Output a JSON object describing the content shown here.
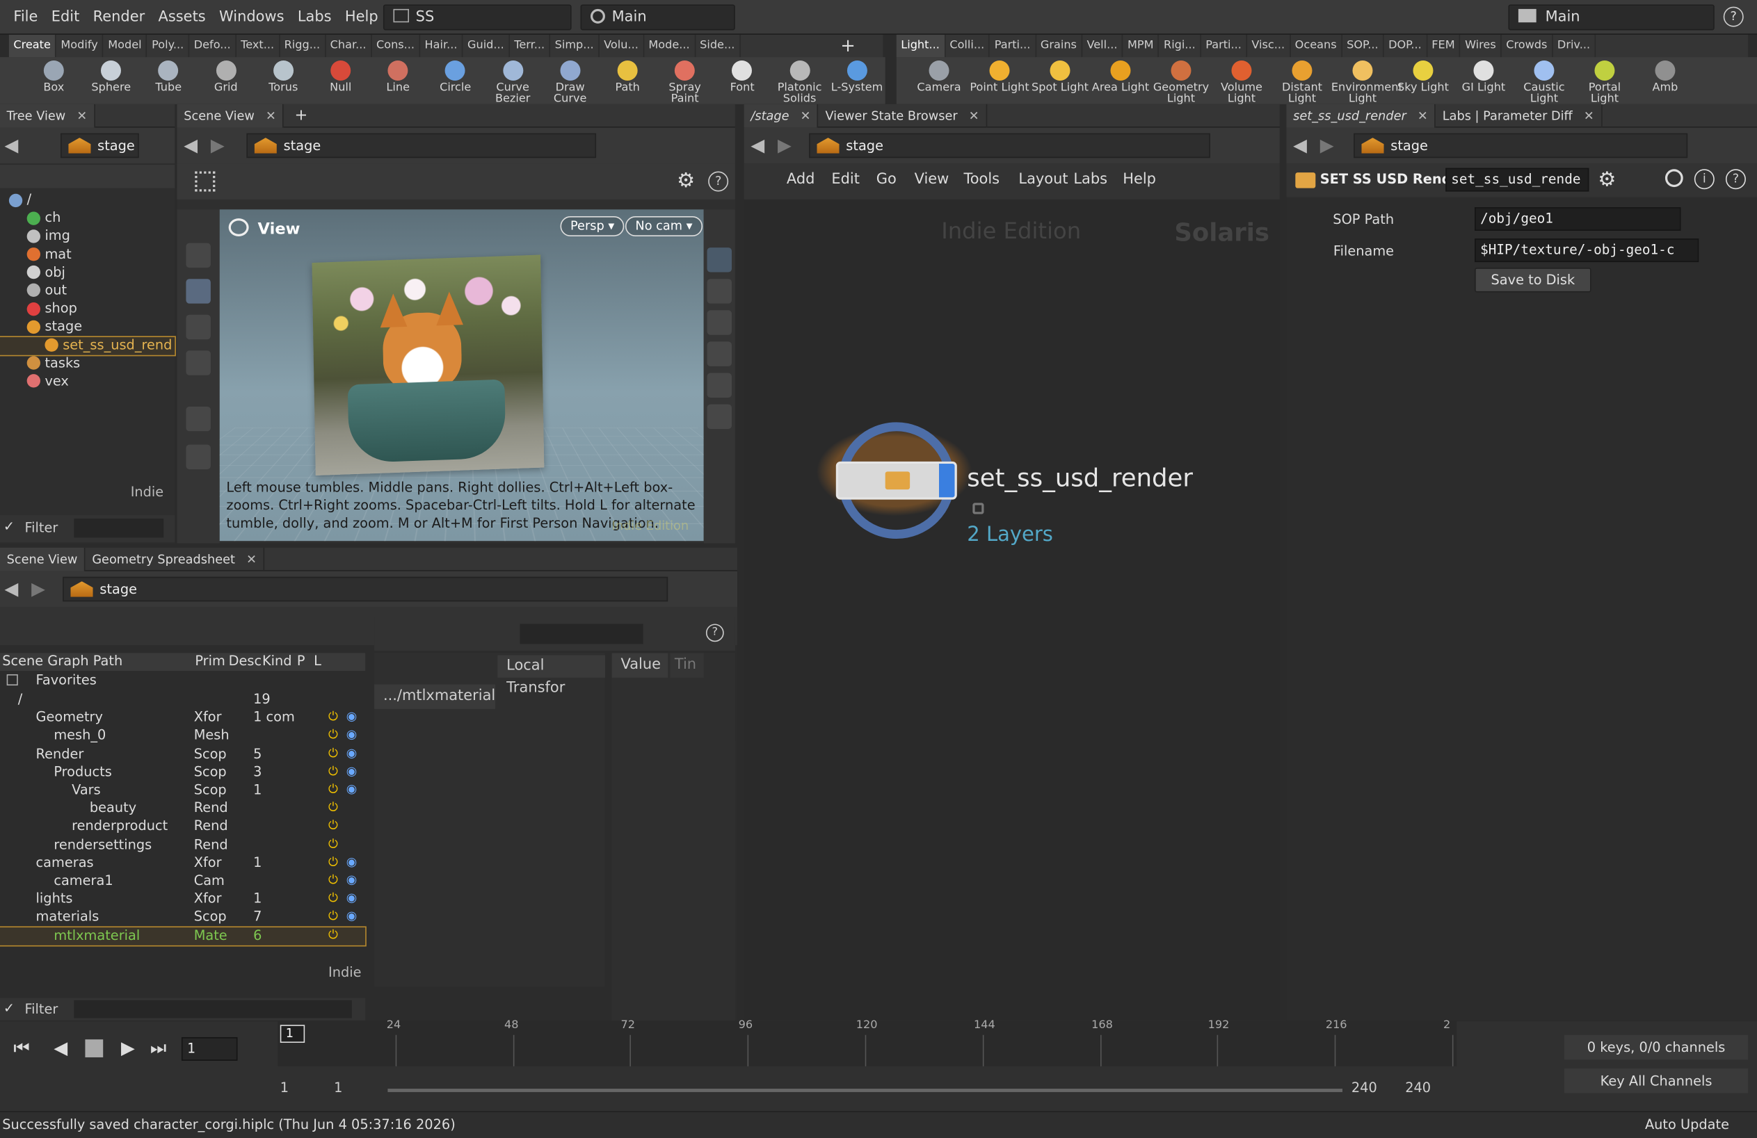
{
  "menubar": {
    "items": [
      "File",
      "Edit",
      "Render",
      "Assets",
      "Windows",
      "Labs",
      "Help"
    ],
    "desktop": "SS",
    "context": "Main",
    "right_context": "Main"
  },
  "shelf": {
    "left_tabs": [
      "Create",
      "Modify",
      "Model",
      "Poly...",
      "Defo...",
      "Text...",
      "Rigg...",
      "Char...",
      "Cons...",
      "Hair...",
      "Guid...",
      "Terr...",
      "Simp...",
      "Volu...",
      "Mode...",
      "Side..."
    ],
    "right_tabs": [
      "Light...",
      "Colli...",
      "Parti...",
      "Grains",
      "Vell...",
      "MPM",
      "Rigi...",
      "Parti...",
      "Visc...",
      "Oceans",
      "SOP...",
      "DOP...",
      "FEM",
      "Wires",
      "Crowds",
      "Driv..."
    ],
    "left_tools": [
      {
        "label": "Box",
        "color": "#9aa6b4"
      },
      {
        "label": "Sphere",
        "color": "#c8d0d8"
      },
      {
        "label": "Tube",
        "color": "#aab4c0"
      },
      {
        "label": "Grid",
        "color": "#b0b0b0"
      },
      {
        "label": "Torus",
        "color": "#b8c4cc"
      },
      {
        "label": "Null",
        "color": "#d84a3a"
      },
      {
        "label": "Line",
        "color": "#d07060"
      },
      {
        "label": "Circle",
        "color": "#6aa0e0"
      },
      {
        "label": "Curve Bezier",
        "color": "#a0b8d8"
      },
      {
        "label": "Draw Curve",
        "color": "#90a8d0"
      },
      {
        "label": "Path",
        "color": "#e8c040"
      },
      {
        "label": "Spray Paint",
        "color": "#e07060"
      },
      {
        "label": "Font",
        "color": "#e0e0e0"
      },
      {
        "label": "Platonic Solids",
        "color": "#b8b8b8"
      },
      {
        "label": "L-System",
        "color": "#5a9ae0"
      }
    ],
    "right_tools": [
      {
        "label": "Camera",
        "color": "#9aa0a8"
      },
      {
        "label": "Point Light",
        "color": "#f0b030"
      },
      {
        "label": "Spot Light",
        "color": "#f0c040"
      },
      {
        "label": "Area Light",
        "color": "#e8a020"
      },
      {
        "label": "Geometry Light",
        "color": "#d07040"
      },
      {
        "label": "Volume Light",
        "color": "#e06030"
      },
      {
        "label": "Distant Light",
        "color": "#e8a030"
      },
      {
        "label": "Environment Light",
        "color": "#f0c060"
      },
      {
        "label": "Sky Light",
        "color": "#e8d040"
      },
      {
        "label": "GI Light",
        "color": "#e0e0e0"
      },
      {
        "label": "Caustic Light",
        "color": "#a0c0f0"
      },
      {
        "label": "Portal Light",
        "color": "#c0d040"
      },
      {
        "label": "Amb",
        "color": "#909090"
      }
    ]
  },
  "tree_view": {
    "tab": "Tree View",
    "path": "stage",
    "items": [
      {
        "label": "/",
        "depth": 0,
        "color": "#7aa0d0"
      },
      {
        "label": "ch",
        "depth": 1,
        "color": "#4caf50"
      },
      {
        "label": "img",
        "depth": 1,
        "color": "#c0c0c0"
      },
      {
        "label": "mat",
        "depth": 1,
        "color": "#e07030"
      },
      {
        "label": "obj",
        "depth": 1,
        "color": "#d0d0d0"
      },
      {
        "label": "out",
        "depth": 1,
        "color": "#b0b0b0"
      },
      {
        "label": "shop",
        "depth": 1,
        "color": "#e04040"
      },
      {
        "label": "stage",
        "depth": 1,
        "color": "#e39a2e"
      },
      {
        "label": "set_ss_usd_rend",
        "depth": 2,
        "color": "#e39a2e"
      },
      {
        "label": "tasks",
        "depth": 1,
        "color": "#d09040"
      },
      {
        "label": "vex",
        "depth": 1,
        "color": "#e07070"
      }
    ],
    "indie_label": "Indie",
    "filter_label": "Filter"
  },
  "scene_view_top": {
    "tab": "Scene View",
    "path": "stage",
    "view_title": "View",
    "persp": "Persp",
    "cam": "No cam",
    "hint": "Left mouse tumbles. Middle pans. Right dollies. Ctrl+Alt+Left box-zooms. Ctrl+Right zooms. Spacebar-Ctrl-Left tilts. Hold L for alternate tumble, dolly, and zoom. M or Alt+M for First Person Navigation.",
    "watermark": "Indie Edition"
  },
  "network": {
    "tabs": [
      "/stage",
      "Viewer State Browser"
    ],
    "path": "stage",
    "menu": [
      "Add",
      "Edit",
      "Go",
      "View",
      "Tools",
      "Layout",
      "Labs",
      "Help"
    ],
    "edition": "Indie Edition",
    "context_label": "Solaris",
    "node_name": "set_ss_usd_render",
    "node_info": "2 Layers"
  },
  "params": {
    "tabs": [
      "set_ss_usd_render",
      "Labs | Parameter Diff"
    ],
    "path": "stage",
    "node_type": "SET SS USD Render",
    "node_name": "set_ss_usd_rende",
    "sop_path_label": "SOP Path",
    "sop_path": "/obj/geo1",
    "filename_label": "Filename",
    "filename": "$HIP/texture/-obj-geo1-c",
    "save_button": "Save to Disk"
  },
  "scene_graph": {
    "tabs": [
      "Scene View",
      "Geometry Spreadsheet"
    ],
    "path": "stage",
    "headers": {
      "path": "Scene Graph Path",
      "prim": "Prim",
      "desc": "Desc",
      "kind": "Kind",
      "p": "P",
      "l": "L"
    },
    "favorites": "Favorites",
    "rows": [
      {
        "name": "/",
        "depth": 0,
        "prim": "",
        "desc": "19",
        "power": false,
        "eye": false
      },
      {
        "name": "Geometry",
        "depth": 1,
        "prim": "Xfor",
        "desc": "1 com",
        "power": true,
        "eye": true
      },
      {
        "name": "mesh_0",
        "depth": 2,
        "prim": "Mesh",
        "desc": "",
        "power": true,
        "eye": true
      },
      {
        "name": "Render",
        "depth": 1,
        "prim": "Scop",
        "desc": "5",
        "power": true,
        "eye": true
      },
      {
        "name": "Products",
        "depth": 2,
        "prim": "Scop",
        "desc": "3",
        "power": true,
        "eye": true
      },
      {
        "name": "Vars",
        "depth": 3,
        "prim": "Scop",
        "desc": "1",
        "power": true,
        "eye": true
      },
      {
        "name": "beauty",
        "depth": 4,
        "prim": "Rend",
        "desc": "",
        "power": true,
        "eye": false
      },
      {
        "name": "renderproduct",
        "depth": 3,
        "prim": "Rend",
        "desc": "",
        "power": true,
        "eye": false
      },
      {
        "name": "rendersettings",
        "depth": 2,
        "prim": "Rend",
        "desc": "",
        "power": true,
        "eye": false
      },
      {
        "name": "cameras",
        "depth": 1,
        "prim": "Xfor",
        "desc": "1",
        "power": true,
        "eye": true
      },
      {
        "name": "camera1",
        "depth": 2,
        "prim": "Cam",
        "desc": "",
        "power": true,
        "eye": true
      },
      {
        "name": "lights",
        "depth": 1,
        "prim": "Xfor",
        "desc": "1",
        "power": true,
        "eye": true
      },
      {
        "name": "materials",
        "depth": 1,
        "prim": "Scop",
        "desc": "7",
        "power": true,
        "eye": true
      },
      {
        "name": "mtlxmaterial",
        "depth": 2,
        "prim": "Mate",
        "desc": "6",
        "power": true,
        "eye": false,
        "selected": true
      }
    ],
    "indie_label": "Indie",
    "filter_label": "Filter"
  },
  "spreadsheet": {
    "local_transform": "Local Transfor",
    "value": "Value",
    "time": "Tin",
    "item": ".../mtlxmaterial"
  },
  "timeline": {
    "frame": "1",
    "ticks": [
      "24",
      "48",
      "72",
      "96",
      "120",
      "144",
      "168",
      "192",
      "216",
      "2"
    ],
    "current_marker": "1",
    "range_start": "1",
    "range_start2": "1",
    "range_end": "240",
    "range_end2": "240",
    "keys": "0 keys, 0/0 channels",
    "key_all": "Key All Channels"
  },
  "status": {
    "message": "Successfully saved character_corgi.hiplc (Thu Jun  4 05:37:16 2026)",
    "auto_update": "Auto Update"
  }
}
